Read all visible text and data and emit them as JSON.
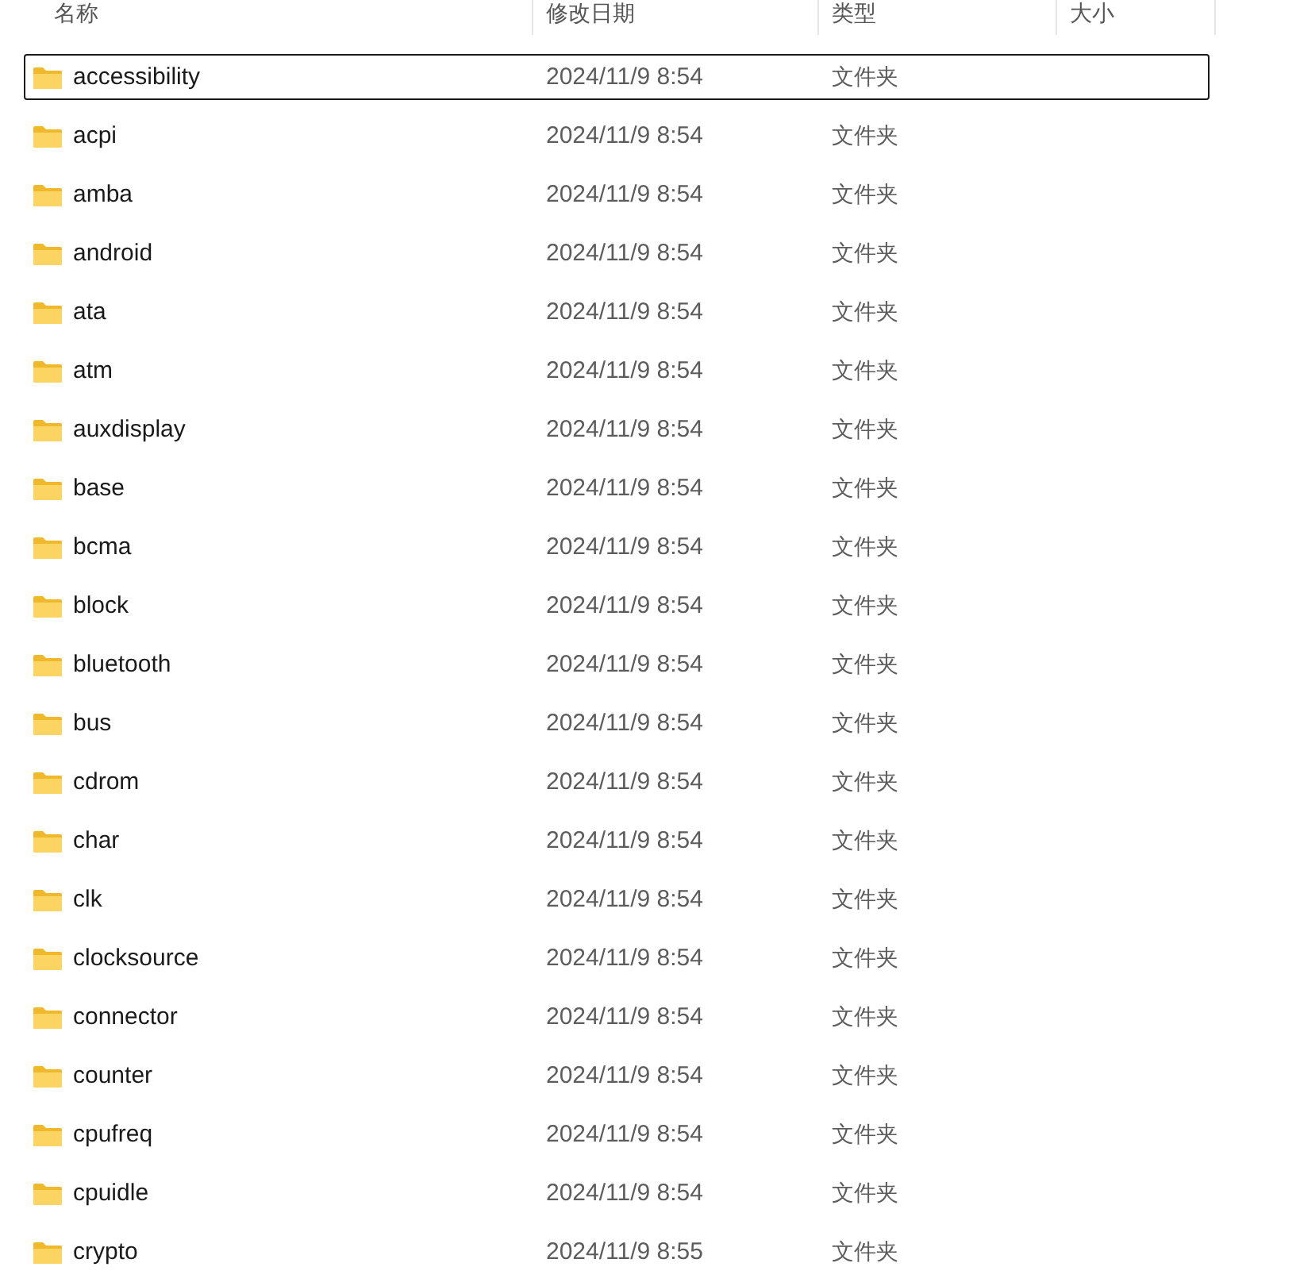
{
  "columns": [
    {
      "label": "名称"
    },
    {
      "label": "修改日期"
    },
    {
      "label": "类型"
    },
    {
      "label": "大小"
    }
  ],
  "rows": [
    {
      "name": "accessibility",
      "modified": "2024/11/9 8:54",
      "type": "文件夹",
      "focused": true
    },
    {
      "name": "acpi",
      "modified": "2024/11/9 8:54",
      "type": "文件夹",
      "focused": false
    },
    {
      "name": "amba",
      "modified": "2024/11/9 8:54",
      "type": "文件夹",
      "focused": false
    },
    {
      "name": "android",
      "modified": "2024/11/9 8:54",
      "type": "文件夹",
      "focused": false
    },
    {
      "name": "ata",
      "modified": "2024/11/9 8:54",
      "type": "文件夹",
      "focused": false
    },
    {
      "name": "atm",
      "modified": "2024/11/9 8:54",
      "type": "文件夹",
      "focused": false
    },
    {
      "name": "auxdisplay",
      "modified": "2024/11/9 8:54",
      "type": "文件夹",
      "focused": false
    },
    {
      "name": "base",
      "modified": "2024/11/9 8:54",
      "type": "文件夹",
      "focused": false
    },
    {
      "name": "bcma",
      "modified": "2024/11/9 8:54",
      "type": "文件夹",
      "focused": false
    },
    {
      "name": "block",
      "modified": "2024/11/9 8:54",
      "type": "文件夹",
      "focused": false
    },
    {
      "name": "bluetooth",
      "modified": "2024/11/9 8:54",
      "type": "文件夹",
      "focused": false
    },
    {
      "name": "bus",
      "modified": "2024/11/9 8:54",
      "type": "文件夹",
      "focused": false
    },
    {
      "name": "cdrom",
      "modified": "2024/11/9 8:54",
      "type": "文件夹",
      "focused": false
    },
    {
      "name": "char",
      "modified": "2024/11/9 8:54",
      "type": "文件夹",
      "focused": false
    },
    {
      "name": "clk",
      "modified": "2024/11/9 8:54",
      "type": "文件夹",
      "focused": false
    },
    {
      "name": "clocksource",
      "modified": "2024/11/9 8:54",
      "type": "文件夹",
      "focused": false
    },
    {
      "name": "connector",
      "modified": "2024/11/9 8:54",
      "type": "文件夹",
      "focused": false
    },
    {
      "name": "counter",
      "modified": "2024/11/9 8:54",
      "type": "文件夹",
      "focused": false
    },
    {
      "name": "cpufreq",
      "modified": "2024/11/9 8:54",
      "type": "文件夹",
      "focused": false
    },
    {
      "name": "cpuidle",
      "modified": "2024/11/9 8:54",
      "type": "文件夹",
      "focused": false
    },
    {
      "name": "crypto",
      "modified": "2024/11/9 8:55",
      "type": "文件夹",
      "focused": false
    }
  ]
}
